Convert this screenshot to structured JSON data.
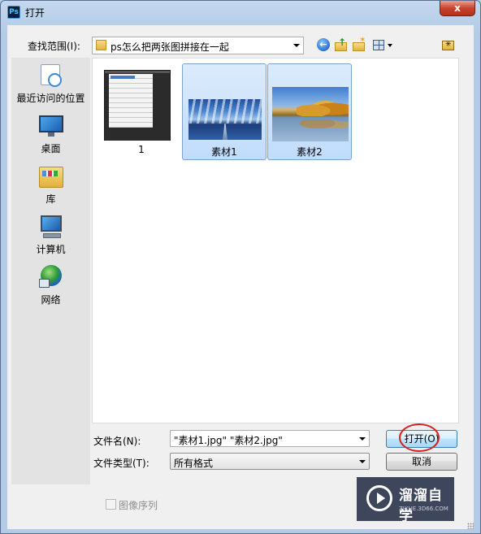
{
  "window": {
    "title": "打开",
    "app_icon": "ps-icon",
    "close_label": "x"
  },
  "lookin": {
    "label": "查找范围(I):",
    "value": "ps怎么把两张图拼接在一起"
  },
  "toolbar_icons": [
    "back-icon",
    "up-folder-icon",
    "new-folder-icon",
    "view-menu-icon",
    "folder-special-icon"
  ],
  "places": [
    {
      "label": "最近访问的位置",
      "icon": "recent-places-icon"
    },
    {
      "label": "桌面",
      "icon": "desktop-icon"
    },
    {
      "label": "库",
      "icon": "libraries-icon"
    },
    {
      "label": "计算机",
      "icon": "computer-icon"
    },
    {
      "label": "网络",
      "icon": "network-icon"
    }
  ],
  "files": [
    {
      "name": "1",
      "selected": false
    },
    {
      "name": "素材1",
      "selected": true
    },
    {
      "name": "素材2",
      "selected": true
    }
  ],
  "filename": {
    "label": "文件名(N):",
    "value": "\"素材1.jpg\" \"素材2.jpg\""
  },
  "filetype": {
    "label": "文件类型(T):",
    "value": "所有格式"
  },
  "buttons": {
    "open": "打开(O)",
    "cancel": "取消"
  },
  "image_sequence": {
    "label": "图像序列",
    "checked": false,
    "enabled": false
  },
  "watermark": {
    "brand": "溜溜自学",
    "url": "ZIXUE.3D66.COM"
  },
  "colors": {
    "selection_bg": "#c1dcfc",
    "selection_border": "#7da2ce",
    "highlight_circle": "#d42222"
  }
}
